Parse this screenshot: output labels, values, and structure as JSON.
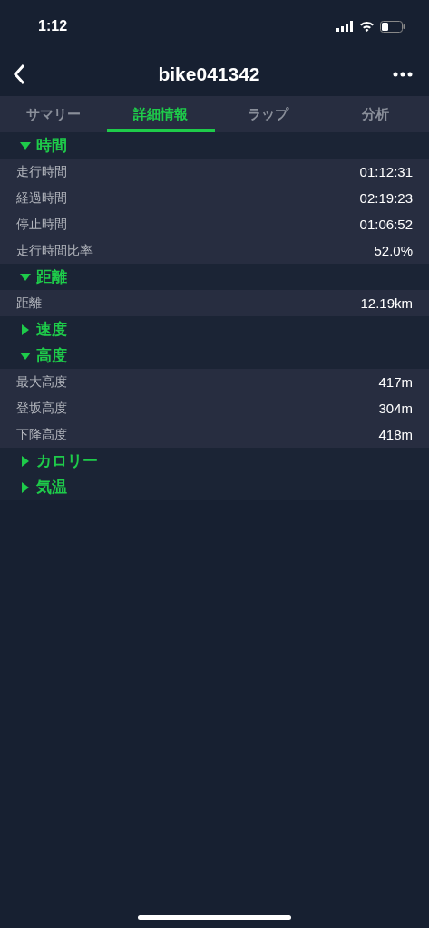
{
  "status_bar": {
    "time": "1:12"
  },
  "nav": {
    "title": "bike041342"
  },
  "tabs": [
    {
      "label": "サマリー",
      "selected": false
    },
    {
      "label": "詳細情報",
      "selected": true
    },
    {
      "label": "ラップ",
      "selected": false
    },
    {
      "label": "分析",
      "selected": false
    }
  ],
  "sections": [
    {
      "title": "時間",
      "expanded": true,
      "rows": [
        {
          "label": "走行時間",
          "value": "01:12:31"
        },
        {
          "label": "経過時間",
          "value": "02:19:23"
        },
        {
          "label": "停止時間",
          "value": "01:06:52"
        },
        {
          "label": "走行時間比率",
          "value": "52.0%"
        }
      ]
    },
    {
      "title": "距離",
      "expanded": true,
      "rows": [
        {
          "label": "距離",
          "value": "12.19km"
        }
      ]
    },
    {
      "title": "速度",
      "expanded": false
    },
    {
      "title": "高度",
      "expanded": true,
      "rows": [
        {
          "label": "最大高度",
          "value": "417m"
        },
        {
          "label": "登坂高度",
          "value": "304m"
        },
        {
          "label": "下降高度",
          "value": "418m"
        }
      ]
    },
    {
      "title": "カロリー",
      "expanded": false
    },
    {
      "title": "気温",
      "expanded": false
    }
  ]
}
